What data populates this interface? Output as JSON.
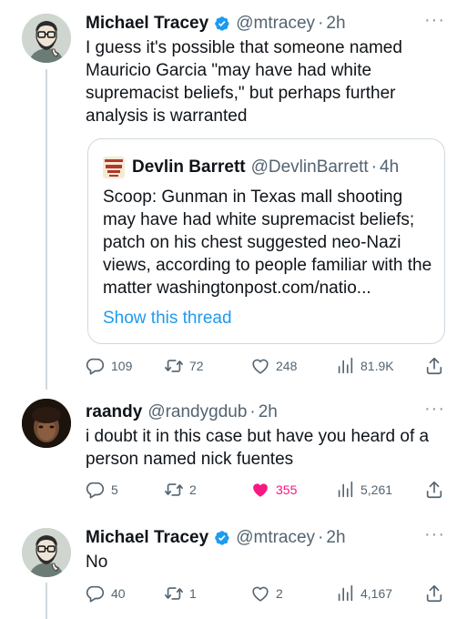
{
  "tweets": [
    {
      "name": "Michael Tracey",
      "handle": "@mtracey",
      "time": "2h",
      "text": "I guess it's possible that someone named Mauricio Garcia \"may have had white supremacist beliefs,\" but perhaps further analysis is warranted",
      "verified": true,
      "quote": {
        "name": "Devlin Barrett",
        "handle": "@DevlinBarrett",
        "time": "4h",
        "text": "Scoop: Gunman in Texas mall shooting may have had white supremacist beliefs; patch on his chest suggested neo-Nazi views, according to people familiar with the matter washingtonpost.com/natio...",
        "show_thread": "Show this thread"
      },
      "stats": {
        "replies": "109",
        "retweets": "72",
        "likes": "248",
        "views": "81.9K"
      }
    },
    {
      "name": "raandy",
      "handle": "@randygdub",
      "time": "2h",
      "text": "i doubt it in this case but have you heard of a person named nick fuentes",
      "verified": false,
      "stats": {
        "replies": "5",
        "retweets": "2",
        "likes": "355",
        "views": "5,261",
        "liked": true
      }
    },
    {
      "name": "Michael Tracey",
      "handle": "@mtracey",
      "time": "2h",
      "text": "No",
      "verified": true,
      "stats": {
        "replies": "40",
        "retweets": "1",
        "likes": "2",
        "views": "4,167"
      }
    }
  ],
  "common": {
    "dot": "·",
    "more": "···"
  },
  "colors": {
    "verified": "#1d9bf0",
    "like_active": "#f91880",
    "link": "#1d9bf0",
    "muted": "#536471"
  }
}
